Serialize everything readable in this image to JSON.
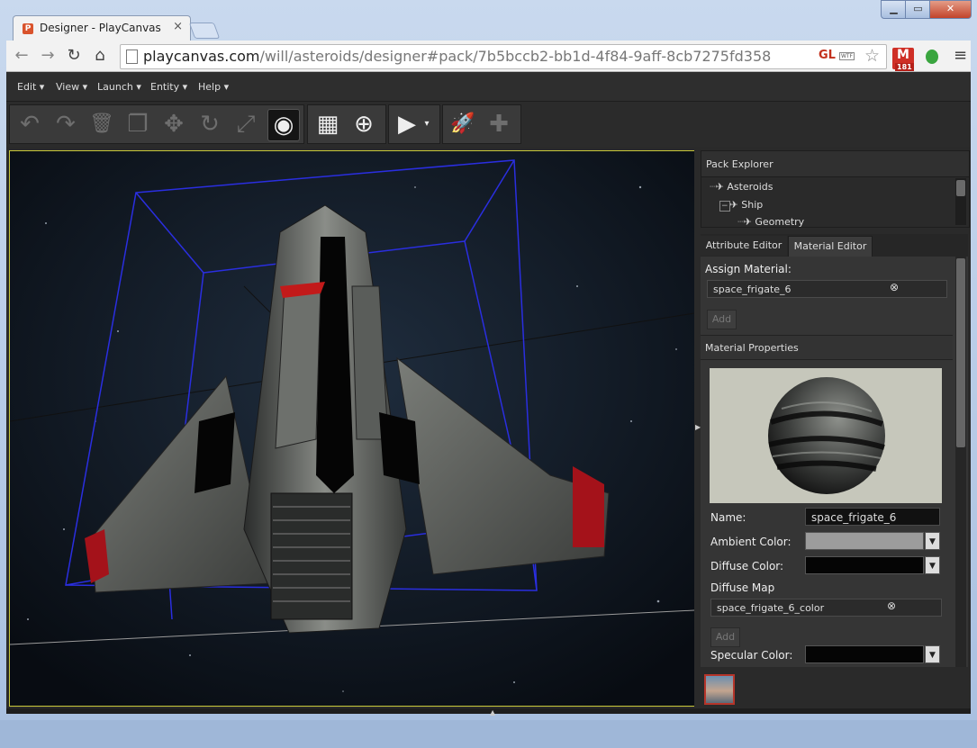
{
  "window": {
    "tab_title": "Designer - PlayCanvas",
    "tab_favicon": "playcanvas-logo-icon",
    "close_glyph": "×",
    "min_glyph": "▁",
    "max_glyph": "▭",
    "winclose_glyph": "✕"
  },
  "browser": {
    "back_glyph": "←",
    "forward_glyph": "→",
    "reload_glyph": "↻",
    "home_glyph": "⌂",
    "url_host": "playcanvas.com",
    "url_path": "/will/asteroids/designer#pack/7b5bccb2-bb1d-4f84-9aff-8cb7275fd358",
    "ext_gl": "GL",
    "ext_wtf": "WTF",
    "star_glyph": "☆",
    "gmail_letter": "M",
    "gmail_count": "181",
    "menu_glyph": "≡"
  },
  "menubar": {
    "items": [
      {
        "label": "Edit ▾"
      },
      {
        "label": "View ▾"
      },
      {
        "label": "Launch ▾"
      },
      {
        "label": "Entity ▾"
      },
      {
        "label": "Help ▾"
      }
    ]
  },
  "tools": {
    "undo": "↶",
    "redo": "↷",
    "delete": "🗑",
    "duplicate": "❐",
    "translate": "✥",
    "rotate": "↻",
    "scale": "⤢",
    "world": "◉",
    "grid": "▦",
    "zoom": "⊕",
    "play": "▶",
    "play_dd": "▾",
    "launch": "🚀",
    "scripts": "✚"
  },
  "explorer": {
    "title": "Pack Explorer",
    "items": [
      {
        "label": "Asteroids"
      },
      {
        "label": "Ship"
      },
      {
        "label": "Geometry"
      }
    ],
    "rocket_glyph": "✈"
  },
  "tabs": {
    "attribute": "Attribute Editor",
    "material": "Material Editor"
  },
  "material_editor": {
    "assign_label": "Assign Material:",
    "assigned_value": "space_frigate_6",
    "add_label": "Add",
    "props_title": "Material Properties",
    "name_label": "Name:",
    "name_value": "space_frigate_6",
    "ambient_label": "Ambient Color:",
    "ambient_color": "#9c9c9c",
    "diffuse_label": "Diffuse Color:",
    "diffuse_color": "#050505",
    "diffuse_map_label": "Diffuse Map",
    "diffuse_map_value": "space_frigate_6_color",
    "add2_label": "Add",
    "specular_label": "Specular Color:",
    "specular_color": "#050505",
    "clear_glyph": "⊗",
    "dd_glyph": "▼"
  }
}
